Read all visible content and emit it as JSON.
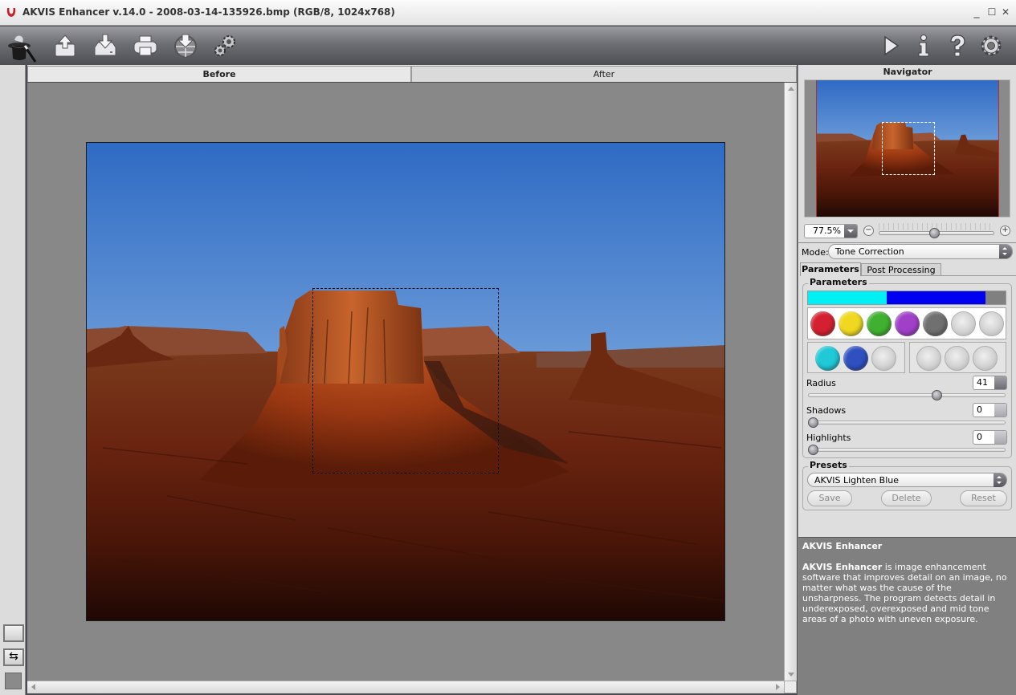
{
  "window": {
    "title": "AKVIS Enhancer v.14.0 - 2008-03-14-135926.bmp (RGB/8, 1024x768)",
    "controls": {
      "minimize": "_",
      "maximize": "☐",
      "close": "✕"
    }
  },
  "toolbar": {
    "left": [
      {
        "name": "logo-hat",
        "icon": "magic-hat-icon"
      },
      {
        "name": "open-image",
        "icon": "upload-icon"
      },
      {
        "name": "save-image",
        "icon": "download-icon"
      },
      {
        "name": "print-image",
        "icon": "printer-icon"
      },
      {
        "name": "share-image",
        "icon": "globe-download-icon"
      },
      {
        "name": "batch-settings",
        "icon": "gears-icon"
      }
    ],
    "right": [
      {
        "name": "run",
        "icon": "play-icon"
      },
      {
        "name": "about",
        "icon": "info-icon"
      },
      {
        "name": "help",
        "icon": "help-icon"
      },
      {
        "name": "preferences",
        "icon": "gear-icon"
      }
    ]
  },
  "tabs": {
    "before": "Before",
    "after": "After",
    "active": "Before"
  },
  "navigator": {
    "title": "Navigator",
    "zoom": "77.5%",
    "zoom_slider_fraction": 0.48
  },
  "mode": {
    "label": "Mode:",
    "value": "Tone Correction"
  },
  "param_tabs": {
    "parameters": "Parameters",
    "post_processing": "Post Processing",
    "active": "Parameters"
  },
  "parameters": {
    "group_title": "Parameters",
    "tone_bar": [
      {
        "color": "#00f0f5",
        "fraction": 0.4
      },
      {
        "color": "#0000f0",
        "fraction": 0.5
      },
      {
        "color": "#808080",
        "fraction": 0.1
      }
    ],
    "swatches_row1": [
      "#d42030",
      "#f0d820",
      "#40b030",
      "#a040c8",
      "#707070",
      null,
      null
    ],
    "swatches_row2a": [
      "#20c8d8",
      "#3050c0",
      null
    ],
    "swatches_row2b": [
      null,
      null,
      null
    ],
    "radius": {
      "label": "Radius",
      "value": "41",
      "fraction": 0.66
    },
    "shadows": {
      "label": "Shadows",
      "value": "0",
      "fraction": 0.0
    },
    "highlights": {
      "label": "Highlights",
      "value": "0",
      "fraction": 0.0
    }
  },
  "presets": {
    "group_title": "Presets",
    "selected": "AKVIS Lighten Blue",
    "save": "Save",
    "delete": "Delete",
    "reset": "Reset"
  },
  "info": {
    "title": "AKVIS Enhancer",
    "bold_lead": "AKVIS Enhancer",
    "text": " is image enhancement software that improves detail on an image, no matter what was the cause of the unsharpness. The program detects detail in underexposed, overexposed and mid tone areas of a photo with uneven exposure."
  }
}
